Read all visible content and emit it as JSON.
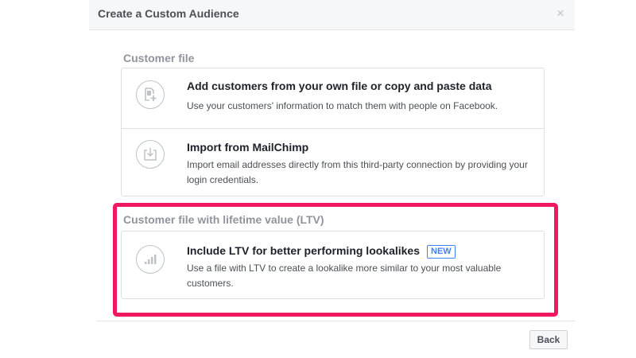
{
  "dialog": {
    "title": "Create a Custom Audience",
    "close_label": "×"
  },
  "sections": {
    "customer_file": {
      "label": "Customer file",
      "options": [
        {
          "title": "Add customers from your own file or copy and paste data",
          "description": "Use your customers' information to match them with people on Facebook.",
          "icon": "file-add-icon"
        },
        {
          "title": "Import from MailChimp",
          "description": "Import email addresses directly from this third-party connection by providing your login credentials.",
          "icon": "import-icon"
        }
      ]
    },
    "ltv": {
      "label": "Customer file with lifetime value (LTV)",
      "options": [
        {
          "title": "Include LTV for better performing lookalikes",
          "badge": "NEW",
          "description": "Use a file with LTV to create a lookalike more similar to your most valuable customers.",
          "icon": "bar-chart-icon"
        }
      ]
    }
  },
  "footer": {
    "back_label": "Back"
  },
  "colors": {
    "highlight": "#f0185e",
    "badge": "#4080ff",
    "icon": "#bec2c9"
  }
}
